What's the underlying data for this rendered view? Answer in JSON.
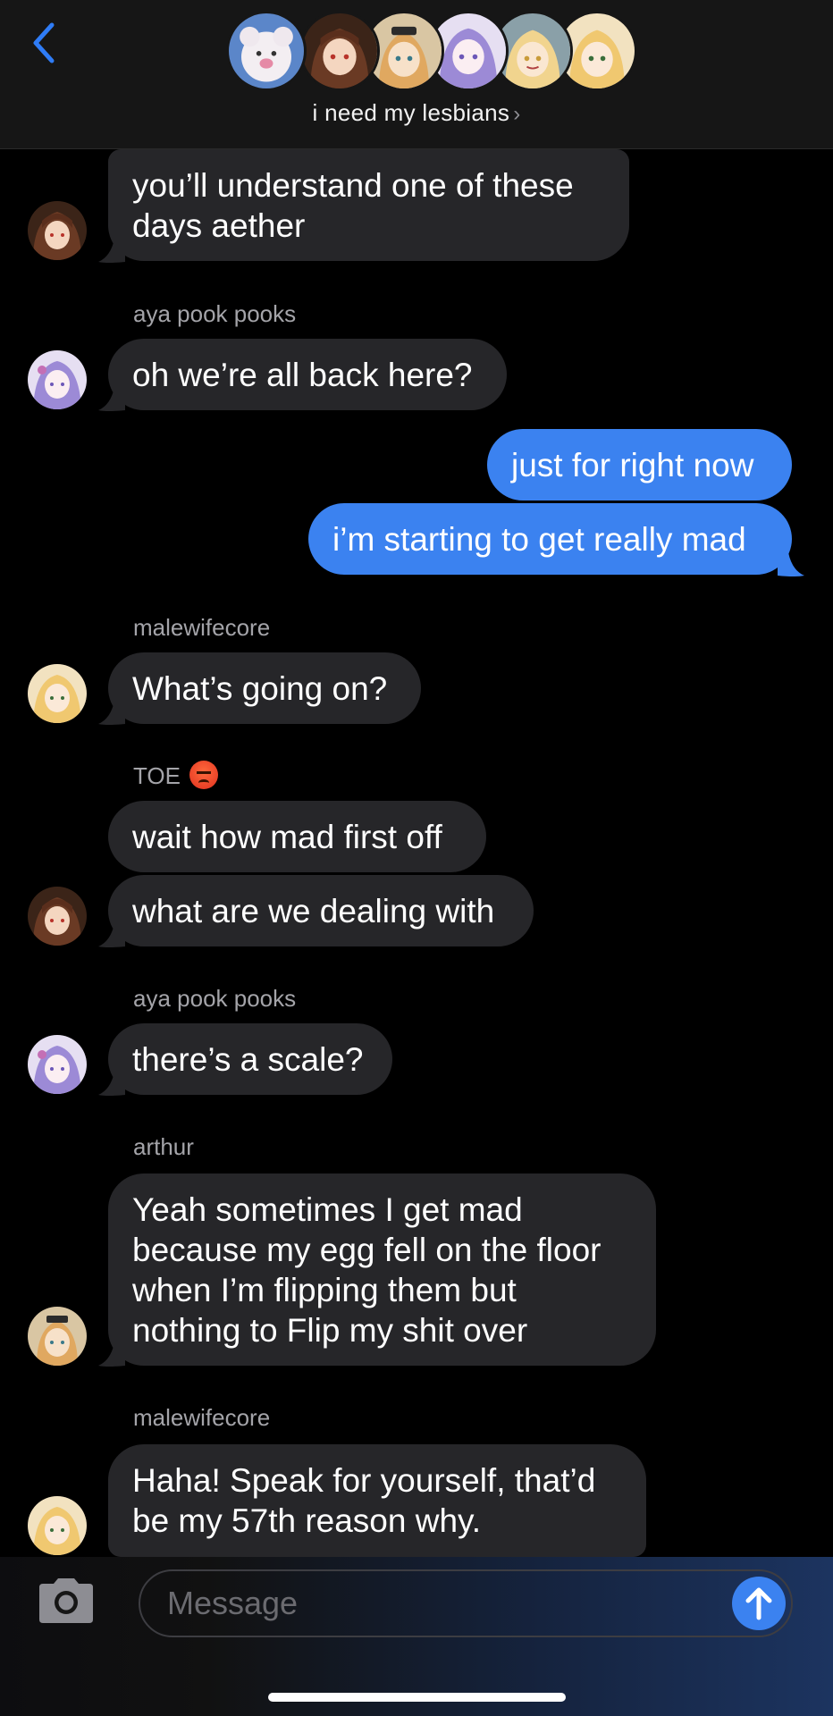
{
  "header": {
    "group_name": "i need my lesbians",
    "chevron": "›",
    "back_icon": "chevron-left-icon",
    "accent": "#2f7cf6"
  },
  "messages": [
    {
      "type": "in",
      "sender": "",
      "text": "you’ll understand one of these days aether",
      "lines": [
        "you’ll understand one of these",
        "days aether"
      ],
      "avatar": "toe"
    },
    {
      "type": "in",
      "sender": "aya pook pooks",
      "text": "oh we’re all back here?",
      "avatar": "aya"
    },
    {
      "type": "out",
      "text": "just for right now"
    },
    {
      "type": "out",
      "text": "i’m starting to get really mad"
    },
    {
      "type": "in",
      "sender": "malewifecore",
      "text": "What’s going on?",
      "avatar": "malewife"
    },
    {
      "type": "in",
      "sender": "TOE",
      "sender_emoji": "angry-face-emoji",
      "text": "wait how mad first off",
      "avatar": ""
    },
    {
      "type": "in",
      "sender": "",
      "text": "what are we dealing with",
      "avatar": "toe"
    },
    {
      "type": "in",
      "sender": "aya pook pooks",
      "text": "there’s a scale?",
      "avatar": "aya"
    },
    {
      "type": "in",
      "sender": "arthur",
      "text": "Yeah sometimes I get mad because my egg fell on the floor when I’m flipping them but nothing to Flip my shit over",
      "lines": [
        "Yeah sometimes I get mad",
        "because my egg fell on the floor",
        "when I’m flipping them but",
        "nothing to Flip my shit over"
      ],
      "avatar": "arthur"
    },
    {
      "type": "in",
      "sender": "malewifecore",
      "text": "Haha! Speak for yourself, that’d be my 57th reason why.",
      "lines": [
        "Haha! Speak for yourself, that’d",
        "be my 57th reason why."
      ],
      "avatar": "malewife"
    }
  ],
  "composer": {
    "placeholder": "Message",
    "camera_icon": "camera-icon",
    "send_icon": "arrow-up-icon"
  },
  "colors": {
    "incoming_bubble": "#262629",
    "outgoing_bubble": "#3b82f0",
    "sender_label": "#a4a4a9"
  }
}
